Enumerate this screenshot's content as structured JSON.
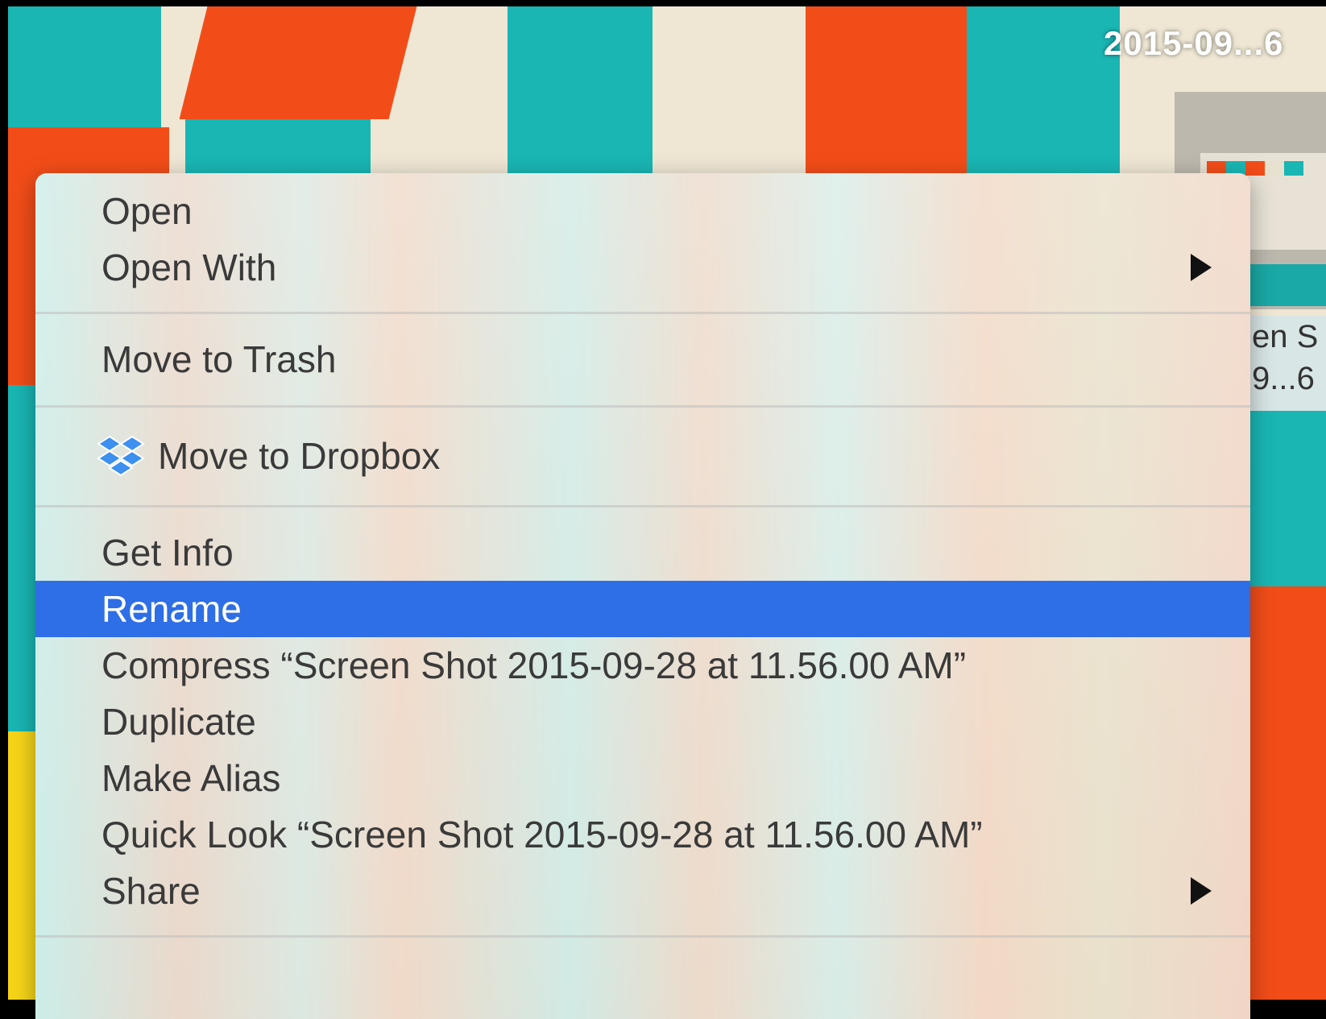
{
  "desktop": {
    "file_label_top": "2015-09...6",
    "file_label_side_1": "en S",
    "file_label_side_2": "9...6"
  },
  "context_menu": {
    "items": [
      {
        "label": "Open"
      },
      {
        "label": "Open With",
        "submenu": true
      },
      {
        "label": "Move to Trash"
      },
      {
        "label": "Move to Dropbox",
        "icon": "dropbox-icon"
      },
      {
        "label": "Get Info"
      },
      {
        "label": "Rename",
        "highlighted": true
      },
      {
        "label": "Compress “Screen Shot 2015-09-28 at 11.56.00 AM”"
      },
      {
        "label": "Duplicate"
      },
      {
        "label": "Make Alias"
      },
      {
        "label": "Quick Look “Screen Shot 2015-09-28 at 11.56.00 AM”"
      },
      {
        "label": "Share",
        "submenu": true
      }
    ],
    "highlight_color": "#2e6ee6"
  }
}
